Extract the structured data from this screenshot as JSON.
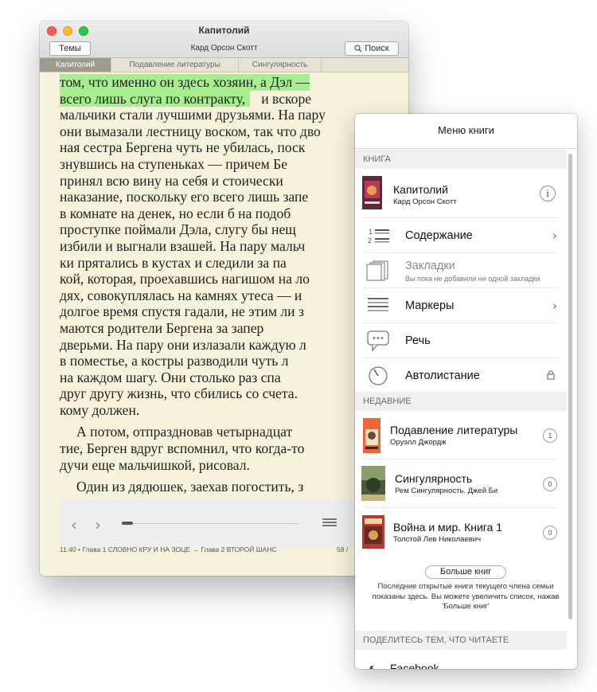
{
  "window": {
    "title": "Капитолий",
    "author": "Кард Орсон Скотт",
    "themes_label": "Темы",
    "search_label": "Поиск",
    "search_icon": "magnifier-icon",
    "tabs": [
      {
        "label": "Капитолий",
        "active": true
      },
      {
        "label": "Подавление литературы",
        "active": false
      },
      {
        "label": "Сингулярность",
        "active": false
      }
    ],
    "highlight_color": "#a6ee8e"
  },
  "text": {
    "lines": [
      [
        "том, что именно он здесь хозяин, а Дэл —"
      ],
      [
        "всего лишь слуга по контракту,",
        "и вскоре"
      ],
      [
        "мальчики стали лучшими друзьями. На пару"
      ],
      [
        "они вымазали лестницу воском, так что дво"
      ],
      [
        "ная сестра Бергена чуть не убилась, поск"
      ],
      [
        "знувшись на ступеньках — причем Бе"
      ],
      [
        "принял всю вину на себя и стоически"
      ],
      [
        "наказание, поскольку его всего лишь запе"
      ],
      [
        "в комнате на денек, но если б на подоб"
      ],
      [
        "проступке поймали Дэла, слугу бы нещ"
      ],
      [
        "избили и выгнали взашей. На пару мальч"
      ],
      [
        "ки прятались в кустах и следили за па"
      ],
      [
        "кой, которая, проехавшись нагишом на ло"
      ],
      [
        "дях, совокуплялась на камнях утеса — и"
      ],
      [
        "долгое время спустя гадали, не этим ли з"
      ],
      [
        "маются родители Бергена за запер"
      ],
      [
        "дверьми. На пару они излазали каждую л"
      ],
      [
        "в поместье, а костры разводили чуть л"
      ],
      [
        "на каждом шагу. Они столько раз спа"
      ],
      [
        "друг другу жизнь, что сбились со счета."
      ],
      [
        "кому должен."
      ]
    ],
    "paragraph2": [
      "А потом, отпраздновав четырнадцат",
      "тие, Берген вдруг вспомнил, что когда-то",
      "дучи еще мальчишкой, рисовал."
    ],
    "paragraph3": [
      "Один из дядюшек, заехав погостить, з"
    ]
  },
  "nav": {
    "prev_icon": "chevron-left-icon",
    "next_icon": "chevron-right-icon",
    "progress": 0.05,
    "menu_icon": "menu-lines-icon"
  },
  "status": {
    "left": "11:40 • Глава 1 СЛОВНО КРУ  И НА ЗОЦЕ → Глава 2 ВТОРОЙ ШАНС",
    "page": "58 /"
  },
  "menu": {
    "title": "Меню книги",
    "section_book": "КНИГА",
    "current_book": {
      "title": "Капитолий",
      "author": "Кард Орсон Скотт",
      "info_icon": "info-icon"
    },
    "items": [
      {
        "label": "Содержание",
        "icon": "toc-icon",
        "arrow": true
      },
      {
        "label": "Закладки",
        "sub": "Вы пока не добавили ни одной закладки",
        "icon": "bookmarks-icon"
      },
      {
        "label": "Маркеры",
        "icon": "markers-icon",
        "arrow": true
      },
      {
        "label": "Речь",
        "icon": "speech-icon"
      },
      {
        "label": "Автолистание",
        "icon": "autoscroll-icon",
        "locked": true
      }
    ],
    "section_recent": "НЕДАВНИЕ",
    "recent": [
      {
        "title": "Подавление литературы",
        "author": "Оруэлл Джордж",
        "count": "1"
      },
      {
        "title": "Сингулярность",
        "author": "Рем Сингулярность. Джей Би",
        "count": "0"
      },
      {
        "title": "Война и мир. Книга 1",
        "author": "Толстой Лев Николаевич",
        "count": "0"
      }
    ],
    "more_label": "Больше книг",
    "recent_note": "Последние открытые книги текущего члена семьи показаны здесь. Вы можете увеличить список, нажав 'Больше книг'",
    "section_share": "ПОДЕЛИТЕСЬ ТЕМ, ЧТО ЧИТАЕТЕ",
    "share_first": "Facebook"
  }
}
